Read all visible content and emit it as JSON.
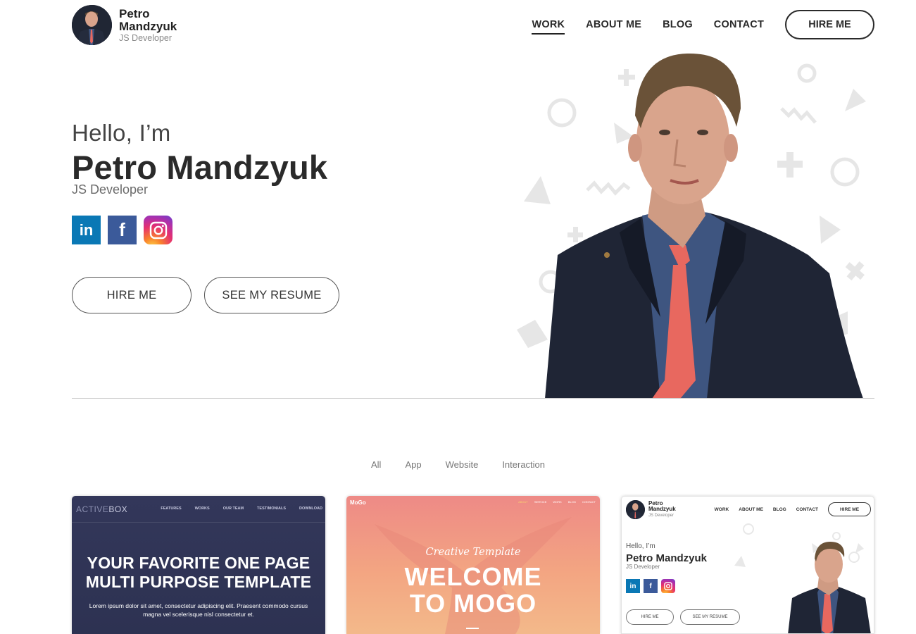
{
  "brand": {
    "name": "Petro Mandzyuk",
    "role": "JS Developer"
  },
  "nav": {
    "items": [
      {
        "label": "WORK",
        "active": true
      },
      {
        "label": "ABOUT ME",
        "active": false
      },
      {
        "label": "BLOG",
        "active": false
      },
      {
        "label": "CONTACT",
        "active": false
      }
    ],
    "hire_label": "HIRE ME"
  },
  "hero": {
    "greeting": "Hello, I’m",
    "name": "Petro Mandzyuk",
    "role": "JS Developer",
    "socials": [
      {
        "name": "linkedin-icon",
        "glyph": "in"
      },
      {
        "name": "facebook-icon",
        "glyph": "f"
      },
      {
        "name": "instagram-icon",
        "glyph": ""
      }
    ],
    "hire_button": "HIRE ME",
    "resume_button": "SEE MY RESUME"
  },
  "portfolio": {
    "filters": [
      "All",
      "App",
      "Website",
      "Interaction"
    ],
    "cards": [
      {
        "logo_a": "ACTIVE",
        "logo_b": "BOX",
        "nav": [
          "FEATURES",
          "WORKS",
          "OUR TEAM",
          "TESTIMONIALS",
          "DOWNLOAD"
        ],
        "title_line1": "YOUR FAVORITE ONE PAGE",
        "title_line2": "MULTI PURPOSE TEMPLATE",
        "subtitle": "Lorem ipsum dolor sit amet, consectetur adipiscing elit. Praesent commodo cursus magna vel scelerisque nisl consectetur et."
      },
      {
        "logo": "MoGo",
        "nav": [
          "ABOUT",
          "SERVICE",
          "WORK",
          "BLOG",
          "CONTACT"
        ],
        "script": "Creative Template",
        "title_line1": "WELCOME",
        "title_line2": "TO MOGO"
      },
      {
        "brand_name": "Petro Mandzyuk",
        "brand_role": "JS Developer",
        "nav": [
          "WORK",
          "ABOUT ME",
          "BLOG",
          "CONTACT"
        ],
        "hire_label": "HIRE ME",
        "greeting": "Hello, I’m",
        "name": "Petro Mandzyuk",
        "role": "JS Developer",
        "socials": [
          "in",
          "f",
          ""
        ],
        "hire_button": "HIRE ME",
        "resume_button": "SEE MY RESUME"
      }
    ]
  },
  "colors": {
    "text": "#2a2a2a",
    "linkedin": "#0a78b5",
    "facebook": "#3b5a9a",
    "card1_bg": "#2f3354",
    "card2_bg": "#f0957f",
    "tie": "#e8685f",
    "suit": "#1f2535"
  }
}
